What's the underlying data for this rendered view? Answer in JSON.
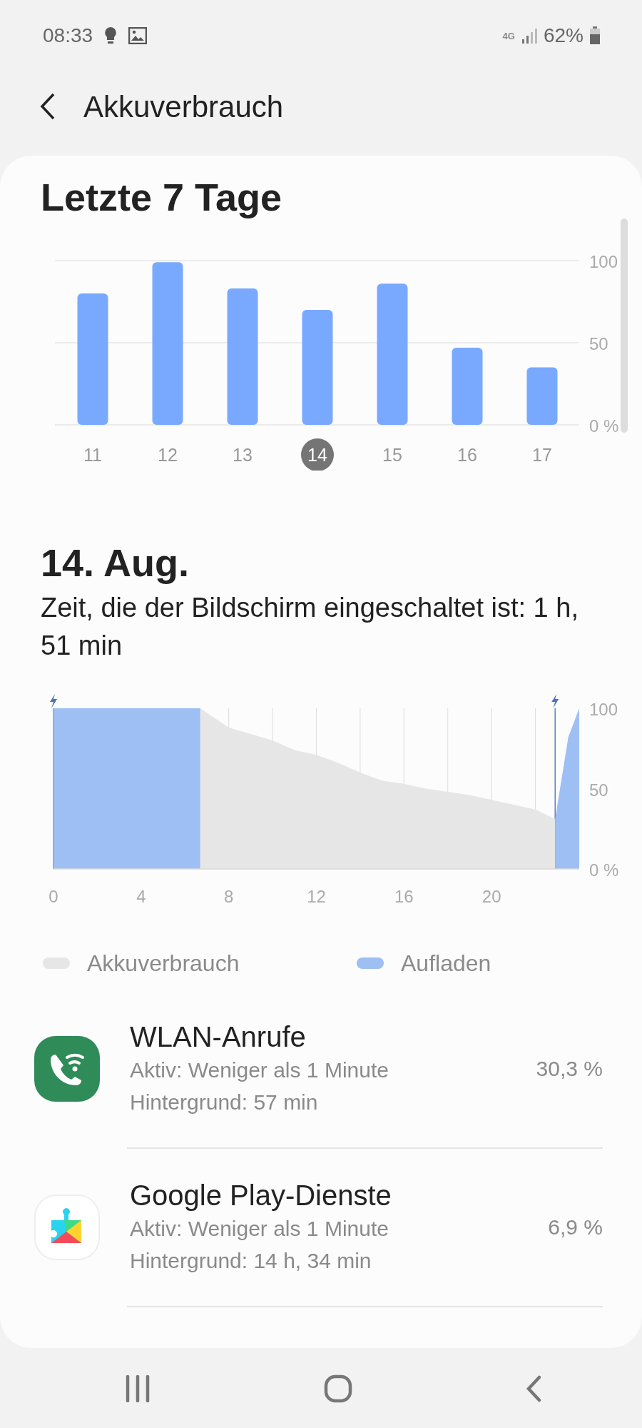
{
  "status_bar": {
    "time": "08:33",
    "network": "4G",
    "battery": "62%"
  },
  "header": {
    "title": "Akkuverbrauch"
  },
  "weekly": {
    "title": "Letzte 7 Tage",
    "days": [
      {
        "selected": false
      },
      {
        "selected": false
      },
      {
        "selected": false
      },
      {
        "selected": true
      },
      {
        "selected": false
      },
      {
        "selected": false
      },
      {
        "selected": false
      }
    ],
    "chart_data": {
      "type": "bar",
      "categories": [
        "11",
        "12",
        "13",
        "14",
        "15",
        "16",
        "17"
      ],
      "series": [
        {
          "color": "#78a9ff",
          "values": [
            80,
            99,
            83,
            70,
            86,
            47,
            35
          ]
        }
      ],
      "ylim": [
        0,
        100
      ],
      "yticks": [
        {
          "value": 0,
          "label": "0 %"
        },
        50,
        100
      ]
    }
  },
  "day": {
    "title": "14. Aug.",
    "screen_time": "Zeit, die der Bildschirm eingeschaltet ist: 1 h, 51 min",
    "chart_data": {
      "type": "area",
      "x": [
        0,
        2,
        4,
        6,
        6.7,
        8,
        9,
        10,
        11,
        12,
        13,
        14,
        15,
        16,
        17,
        18,
        19,
        20,
        21,
        22,
        22.9,
        23.5,
        24
      ],
      "series": [
        {
          "name": "Akkuverbrauch",
          "color": "#e6e6e6",
          "values": [
            null,
            null,
            null,
            null,
            100,
            88,
            84,
            80,
            74,
            71,
            66,
            60,
            55,
            53,
            50,
            48,
            46,
            43,
            40,
            37,
            31,
            null,
            null
          ]
        },
        {
          "name": "Aufladen",
          "color": "#9dbff4",
          "values": [
            100,
            100,
            100,
            100,
            100,
            null,
            null,
            null,
            null,
            null,
            null,
            null,
            null,
            null,
            null,
            null,
            null,
            null,
            null,
            null,
            31,
            82,
            100
          ]
        }
      ],
      "xlim": [
        0,
        24
      ],
      "ylim": [
        0,
        100
      ],
      "grid": true,
      "xticks": [
        0,
        4,
        8,
        12,
        16,
        20
      ],
      "yticks": [
        {
          "value": 0,
          "label": "0 %"
        },
        50,
        100
      ]
    }
  },
  "apps": [
    {
      "kind": "wifi-call",
      "name": "WLAN-Anrufe",
      "active": "Aktiv: Weniger als 1 Minute",
      "background": "Hintergrund: 57 min",
      "percent": "30,3 %"
    },
    {
      "kind": "play-services",
      "name": "Google Play-Dienste",
      "active": "Aktiv: Weniger als 1 Minute",
      "background": "Hintergrund: 14 h, 34 min",
      "percent": "6,9 %"
    }
  ]
}
